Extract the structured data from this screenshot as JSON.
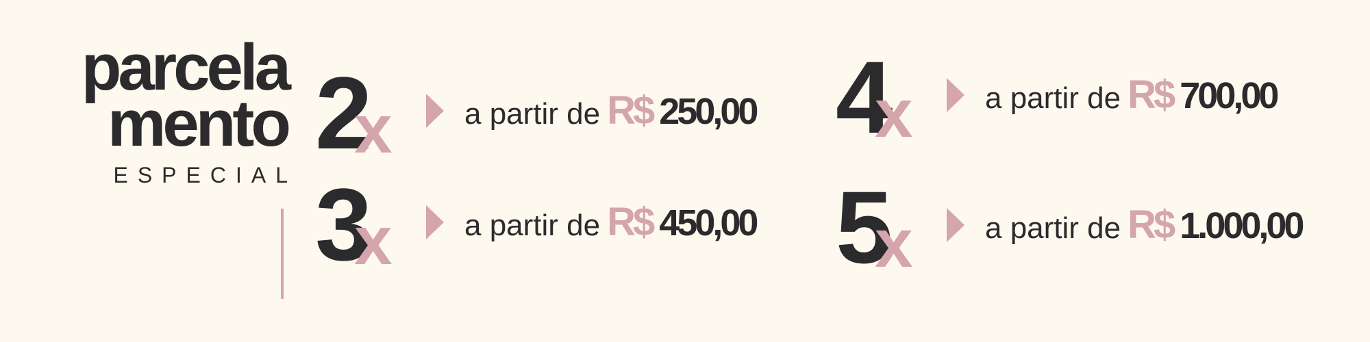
{
  "heading": {
    "line1": "parcela",
    "line2": "mento",
    "subtitle": "ESPECIAL"
  },
  "plans": [
    {
      "number": "2",
      "multiplier": "x",
      "prefix": "a partir de",
      "currency": "R$",
      "amount": "250,00"
    },
    {
      "number": "3",
      "multiplier": "x",
      "prefix": "a partir de",
      "currency": "R$",
      "amount": "450,00"
    },
    {
      "number": "4",
      "multiplier": "x",
      "prefix": "a partir de",
      "currency": "R$",
      "amount": "700,00"
    },
    {
      "number": "5",
      "multiplier": "x",
      "prefix": "a partir de",
      "currency": "R$",
      "amount": "1.000,00"
    }
  ],
  "colors": {
    "background": "#fdf9ee",
    "text": "#2b2a2c",
    "accent": "#d4a5ad"
  },
  "icons": {
    "bullet": "triangle-right-icon"
  }
}
